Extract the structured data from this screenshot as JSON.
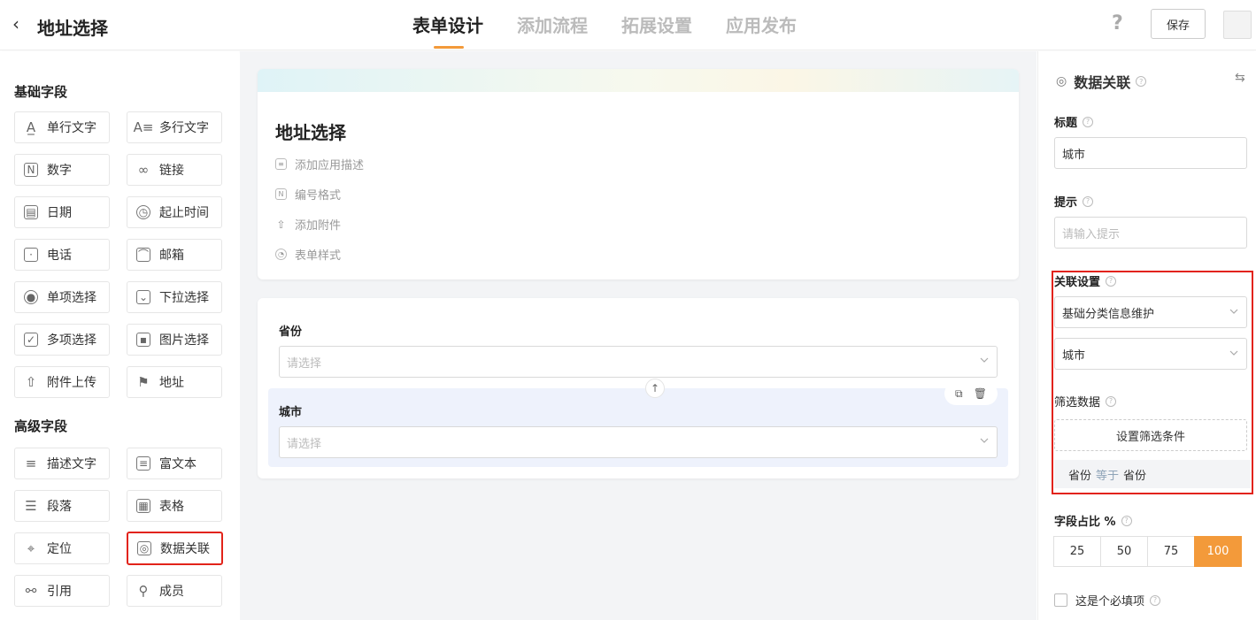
{
  "header": {
    "back_icon": "chevron-left-icon",
    "title": "地址选择",
    "tabs": [
      {
        "label": "表单设计",
        "active": true
      },
      {
        "label": "添加流程",
        "active": false
      },
      {
        "label": "拓展设置",
        "active": false
      },
      {
        "label": "应用发布",
        "active": false
      }
    ],
    "help_label": "?",
    "save_label": "保存"
  },
  "left": {
    "basic_title": "基础字段",
    "basic_fields": [
      {
        "label": "单行文字",
        "icon": "text-line-icon",
        "glyph": "A"
      },
      {
        "label": "多行文字",
        "icon": "text-multiline-icon",
        "glyph": "A"
      },
      {
        "label": "数字",
        "icon": "number-icon",
        "glyph": "N"
      },
      {
        "label": "链接",
        "icon": "link-icon",
        "glyph": "∞"
      },
      {
        "label": "日期",
        "icon": "calendar-icon",
        "glyph": "▤"
      },
      {
        "label": "起止时间",
        "icon": "clock-icon",
        "glyph": "◷"
      },
      {
        "label": "电话",
        "icon": "phone-icon",
        "glyph": "▯"
      },
      {
        "label": "邮箱",
        "icon": "mail-icon",
        "glyph": "✉"
      },
      {
        "label": "单项选择",
        "icon": "radio-icon",
        "glyph": "◉"
      },
      {
        "label": "下拉选择",
        "icon": "dropdown-icon",
        "glyph": "⌄"
      },
      {
        "label": "多项选择",
        "icon": "checkbox-icon",
        "glyph": "✓"
      },
      {
        "label": "图片选择",
        "icon": "image-icon",
        "glyph": "▣"
      },
      {
        "label": "附件上传",
        "icon": "upload-icon",
        "glyph": "⇧"
      },
      {
        "label": "地址",
        "icon": "address-icon",
        "glyph": "⚑"
      }
    ],
    "advanced_title": "高级字段",
    "advanced_fields": [
      {
        "label": "描述文字",
        "icon": "description-icon",
        "glyph": "≡"
      },
      {
        "label": "富文本",
        "icon": "richtext-icon",
        "glyph": "≣"
      },
      {
        "label": "段落",
        "icon": "paragraph-icon",
        "glyph": "☰"
      },
      {
        "label": "表格",
        "icon": "table-icon",
        "glyph": "▦"
      },
      {
        "label": "定位",
        "icon": "location-icon",
        "glyph": "⌖"
      },
      {
        "label": "数据关联",
        "icon": "data-link-icon",
        "glyph": "◎"
      },
      {
        "label": "引用",
        "icon": "reference-icon",
        "glyph": "⚯"
      },
      {
        "label": "成员",
        "icon": "member-icon",
        "glyph": "⚲"
      }
    ]
  },
  "canvas": {
    "form_title": "地址选择",
    "meta": [
      {
        "label": "添加应用描述",
        "icon": "comment-icon"
      },
      {
        "label": "编号格式",
        "icon": "number-format-icon"
      },
      {
        "label": "添加附件",
        "icon": "upload-icon"
      },
      {
        "label": "表单样式",
        "icon": "palette-icon"
      }
    ],
    "province_label": "省份",
    "province_placeholder": "请选择",
    "city_label": "城市",
    "city_placeholder": "请选择"
  },
  "right": {
    "header": "数据关联",
    "title_label": "标题",
    "title_value": "城市",
    "hint_label": "提示",
    "hint_placeholder": "请输入提示",
    "link_settings_label": "关联设置",
    "link_source": "基础分类信息维护",
    "link_field": "城市",
    "filter_label": "筛选数据",
    "filter_button": "设置筛选条件",
    "condition": {
      "left": "省份",
      "op": "等于",
      "right": "省份"
    },
    "ratio_label": "字段占比 %",
    "ratio_options": [
      "25",
      "50",
      "75",
      "100"
    ],
    "ratio_selected": "100",
    "required_label": "这是个必填项"
  },
  "colors": {
    "accent": "#f39a3a",
    "highlight": "#e2231a"
  }
}
